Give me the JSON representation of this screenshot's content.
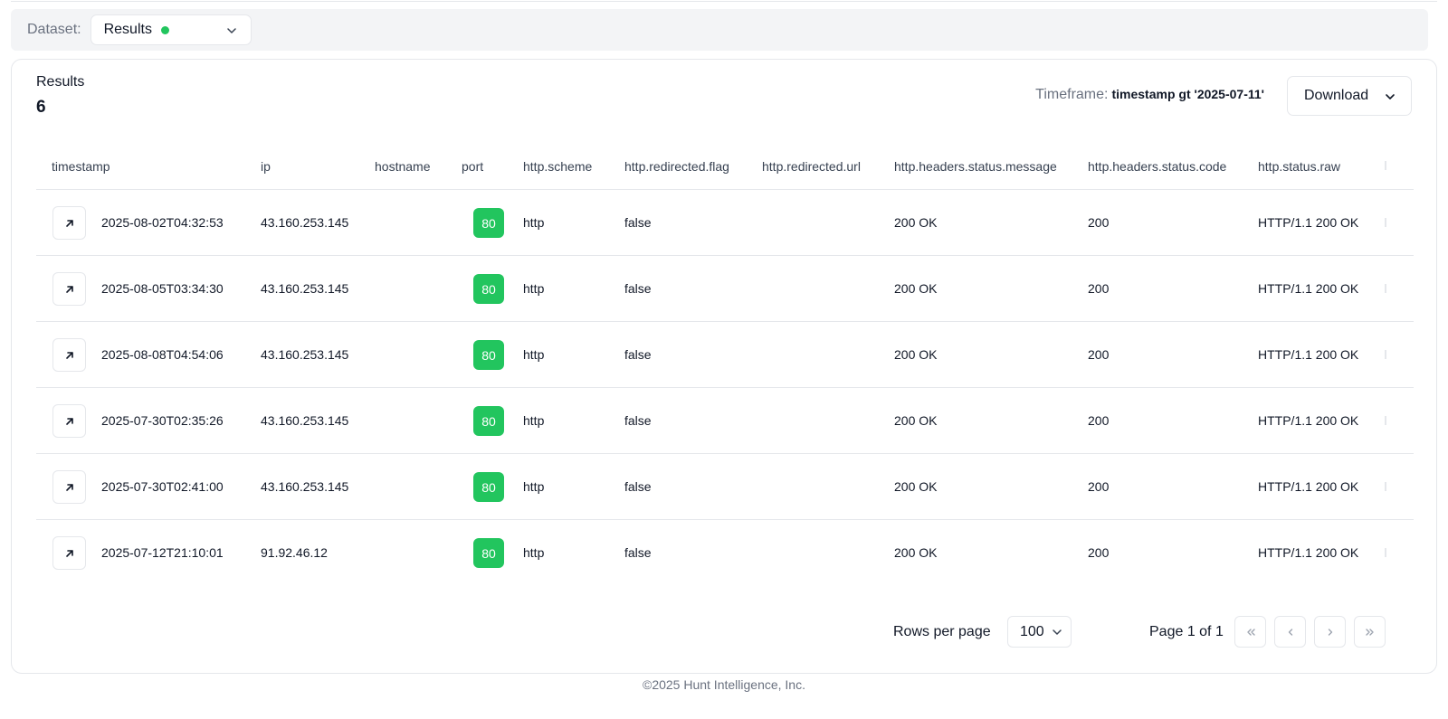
{
  "dataset": {
    "label": "Dataset:",
    "value": "Results",
    "status_color": "#22c55e"
  },
  "results": {
    "title": "Results",
    "count": "6"
  },
  "timeframe": {
    "label": "Timeframe:",
    "value": "timestamp gt '2025-07-11'"
  },
  "download": {
    "label": "Download"
  },
  "columns": [
    "timestamp",
    "ip",
    "hostname",
    "port",
    "http.scheme",
    "http.redirected.flag",
    "http.redirected.url",
    "http.headers.status.message",
    "http.headers.status.code",
    "http.status.raw"
  ],
  "rows": [
    {
      "timestamp": "2025-08-02T04:32:53",
      "ip": "43.160.253.145",
      "hostname": "",
      "port": "80",
      "scheme": "http",
      "redirected_flag": "false",
      "redirected_url": "",
      "status_message": "200 OK",
      "status_code": "200",
      "status_raw": "HTTP/1.1 200 OK"
    },
    {
      "timestamp": "2025-08-05T03:34:30",
      "ip": "43.160.253.145",
      "hostname": "",
      "port": "80",
      "scheme": "http",
      "redirected_flag": "false",
      "redirected_url": "",
      "status_message": "200 OK",
      "status_code": "200",
      "status_raw": "HTTP/1.1 200 OK"
    },
    {
      "timestamp": "2025-08-08T04:54:06",
      "ip": "43.160.253.145",
      "hostname": "",
      "port": "80",
      "scheme": "http",
      "redirected_flag": "false",
      "redirected_url": "",
      "status_message": "200 OK",
      "status_code": "200",
      "status_raw": "HTTP/1.1 200 OK"
    },
    {
      "timestamp": "2025-07-30T02:35:26",
      "ip": "43.160.253.145",
      "hostname": "",
      "port": "80",
      "scheme": "http",
      "redirected_flag": "false",
      "redirected_url": "",
      "status_message": "200 OK",
      "status_code": "200",
      "status_raw": "HTTP/1.1 200 OK"
    },
    {
      "timestamp": "2025-07-30T02:41:00",
      "ip": "43.160.253.145",
      "hostname": "",
      "port": "80",
      "scheme": "http",
      "redirected_flag": "false",
      "redirected_url": "",
      "status_message": "200 OK",
      "status_code": "200",
      "status_raw": "HTTP/1.1 200 OK"
    },
    {
      "timestamp": "2025-07-12T21:10:01",
      "ip": "91.92.46.12",
      "hostname": "",
      "port": "80",
      "scheme": "http",
      "redirected_flag": "false",
      "redirected_url": "",
      "status_message": "200 OK",
      "status_code": "200",
      "status_raw": "HTTP/1.1 200 OK"
    }
  ],
  "pagination": {
    "rows_label": "Rows per page",
    "rows_value": "100",
    "page_label": "Page 1 of 1"
  },
  "icons": {
    "open_row": "arrow-up-right-icon",
    "first": "chevrons-left-icon",
    "prev": "chevron-left-icon",
    "next": "chevron-right-icon",
    "last": "chevrons-right-icon"
  },
  "footer": {
    "text": "©2025 Hunt Intelligence, Inc."
  }
}
